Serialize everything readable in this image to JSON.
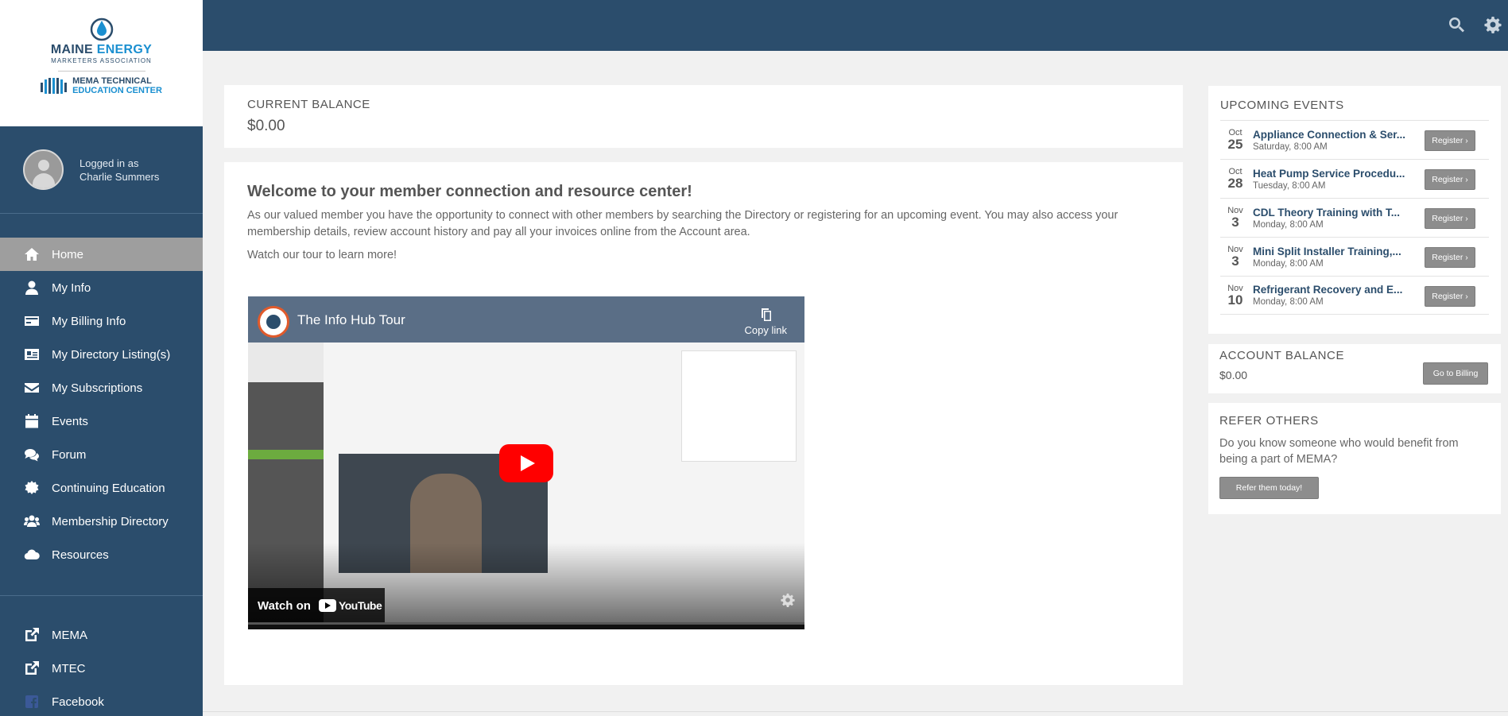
{
  "brand": {
    "line1_a": "MAINE",
    "line1_b": "ENERGY",
    "line2": "MARKETERS ASSOCIATION",
    "tec_line1_a": "MEMA",
    "tec_line1_b": "TECHNICAL",
    "tec_line2": "EDUCATION CENTER"
  },
  "user": {
    "logged_in_label": "Logged in as",
    "name": "Charlie Summers"
  },
  "nav": {
    "items": [
      {
        "label": "Home",
        "icon": "home-icon"
      },
      {
        "label": "My Info",
        "icon": "user-icon"
      },
      {
        "label": "My Billing Info",
        "icon": "credit-card-icon"
      },
      {
        "label": "My Directory Listing(s)",
        "icon": "id-card-icon"
      },
      {
        "label": "My Subscriptions",
        "icon": "envelope-icon"
      },
      {
        "label": "Events",
        "icon": "calendar-icon"
      },
      {
        "label": "Forum",
        "icon": "comments-icon"
      },
      {
        "label": "Continuing Education",
        "icon": "certificate-icon"
      },
      {
        "label": "Membership Directory",
        "icon": "users-icon"
      },
      {
        "label": "Resources",
        "icon": "cloud-icon"
      }
    ],
    "links": [
      {
        "label": "MEMA",
        "icon": "external-link-icon"
      },
      {
        "label": "MTEC",
        "icon": "external-link-icon"
      },
      {
        "label": "Facebook",
        "icon": "facebook-icon"
      }
    ]
  },
  "balance": {
    "label": "CURRENT BALANCE",
    "amount": "$0.00"
  },
  "welcome": {
    "title": "Welcome to your member connection and resource center!",
    "text": "As our valued member you have the opportunity to connect with other members by searching the Directory or registering for an upcoming event. You may also access your membership details, review account history and pay all your invoices online from the Account area.",
    "tour": "Watch our tour to learn more!"
  },
  "video": {
    "title": "The Info Hub Tour",
    "copy_link": "Copy link",
    "watch_on": "Watch on",
    "youtube": "YouTube"
  },
  "events": {
    "title": "UPCOMING EVENTS",
    "register_label": "Register ›",
    "items": [
      {
        "month": "Oct",
        "day": "25",
        "name": "Appliance Connection & Ser...",
        "time": "Saturday, 8:00 AM"
      },
      {
        "month": "Oct",
        "day": "28",
        "name": "Heat Pump Service Procedu...",
        "time": "Tuesday, 8:00 AM"
      },
      {
        "month": "Nov",
        "day": "3",
        "name": "CDL Theory Training with T...",
        "time": "Monday, 8:00 AM"
      },
      {
        "month": "Nov",
        "day": "3",
        "name": "Mini Split Installer Training,...",
        "time": "Monday, 8:00 AM"
      },
      {
        "month": "Nov",
        "day": "10",
        "name": "Refrigerant Recovery and E...",
        "time": "Monday, 8:00 AM"
      }
    ]
  },
  "account": {
    "title": "ACCOUNT BALANCE",
    "amount": "$0.00",
    "button": "Go to Billing"
  },
  "refer": {
    "title": "REFER OTHERS",
    "text": "Do you know someone who would benefit from being a part of MEMA?",
    "button": "Refer them today!"
  },
  "colors": {
    "sidebar": "#2b4d6c",
    "active": "#9e9e9e",
    "link": "#2b4d6c"
  }
}
